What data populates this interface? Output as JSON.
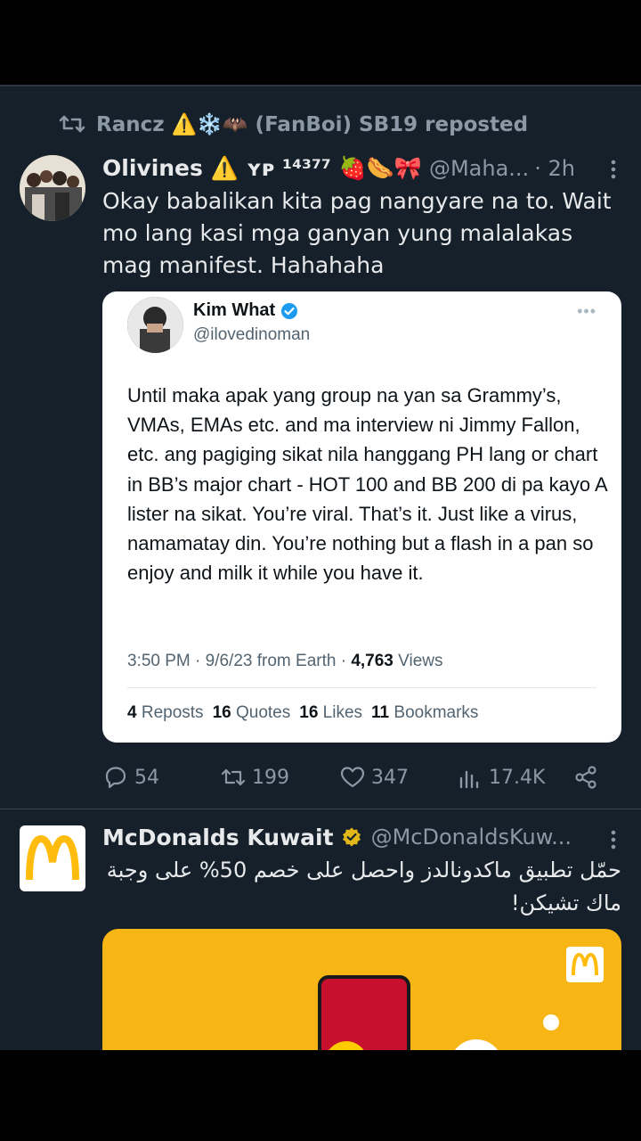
{
  "repost": {
    "label": "Rancz ⚠️❄️🦇 (FanBoi) SB19 reposted",
    "icon": "repost-icon"
  },
  "tweet": {
    "display_name": "Olivines ⚠️ ʏᴘ ¹⁴³⁷⁷ 🍓🌭🎀",
    "handle": "@Maha...",
    "time": "· 2h",
    "text": "Okay babalikan kita pag nangyare na to. Wait mo lang kasi mga ganyan yung malalakas mag manifest. Hahahaha"
  },
  "quoted": {
    "name": "Kim What",
    "verified": true,
    "username": "@ilovedinoman",
    "body": "Until maka apak yang group na yan sa Grammy’s, VMAs, EMAs etc. and ma interview ni Jimmy Fallon, etc. ang pagiging sikat nila hanggang PH lang or chart in BB’s major chart - HOT 100 and BB 200 di pa kayo A lister na sikat. You’re viral. That’s it. Just like a virus, namamatay din. You’re nothing but a flash in a pan so enjoy and milk it while you have it.",
    "meta": "3:50 PM · 9/6/23 from Earth · ",
    "views_count": "4,763",
    "views_label": " Views",
    "reposts_count": "4",
    "reposts_label": "Reposts",
    "quotes_count": "16",
    "quotes_label": "Quotes",
    "likes_count": "16",
    "likes_label": "Likes",
    "bookmarks_count": "11",
    "bookmarks_label": "Bookmarks"
  },
  "actions": {
    "replies": "54",
    "reposts": "199",
    "likes": "347",
    "views": "17.4K"
  },
  "tweet2": {
    "display_name": "McDonalds Kuwait",
    "verified_badge": "gold",
    "handle": "@McDonaldsKuw...",
    "text": "حمّل تطبيق ماكدونالدز واحصل على خصم 50% على وجبة ماك تشيكن!"
  },
  "colors": {
    "background": "#15202b",
    "secondary_text": "#8b98a5",
    "verified_blue": "#1d9bf0",
    "verified_gold": "#e2b719",
    "promo_yellow": "#f7b615"
  }
}
